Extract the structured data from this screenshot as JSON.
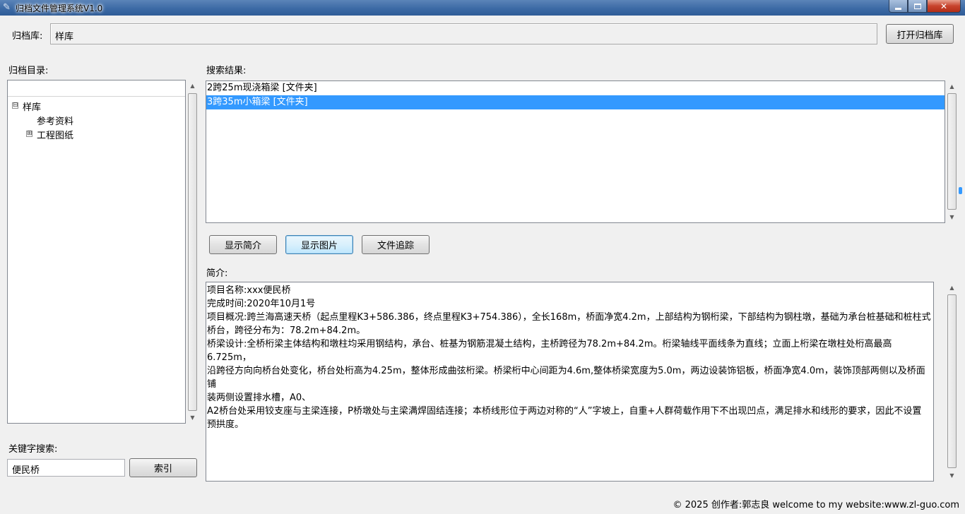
{
  "window": {
    "title": "归档文件管理系统V1.0",
    "controls": {
      "minimize": "minimize-icon",
      "maximize": "maximize-icon",
      "close": "close-icon"
    }
  },
  "archive": {
    "label": "归档库:",
    "path_value": "样库",
    "open_button": "打开归档库"
  },
  "directory": {
    "label": "归档目录:",
    "tree": [
      {
        "label": "样库",
        "expander": "⊟"
      },
      {
        "label": "参考资料"
      },
      {
        "label": "工程图纸",
        "expander": "⊞"
      }
    ]
  },
  "search_results": {
    "label": "搜索结果:",
    "rows": [
      {
        "text": "2跨25m现浇箱梁 [文件夹]",
        "selected": false
      },
      {
        "text": "3跨35m小箱梁 [文件夹]",
        "selected": true
      }
    ]
  },
  "actions": {
    "show_intro": "显示简介",
    "show_image": "显示图片",
    "file_trace": "文件追踪"
  },
  "intro": {
    "label": "简介:",
    "lines": [
      "项目名称:xxx便民桥",
      "完成时间:2020年10月1号",
      "项目概况:跨兰海高速天桥（起点里程K3+586.386，终点里程K3+754.386），全长168m，桥面净宽4.2m，上部结构为钢桁梁，下部结构为钢柱墩，基础为承台桩基础和桩柱式",
      "桥台，跨径分布为：78.2m+84.2m。",
      "桥梁设计:全桥桁梁主体结构和墩柱均采用钢结构，承台、桩基为钢筋混凝土结构，主桥跨径为78.2m+84.2m。桁梁轴线平面线条为直线；立面上桁梁在墩柱处桁高最高6.725m，",
      "沿跨径方向向桥台处变化，桥台处桁高为4.25m，整体形成曲弦桁梁。桥梁桁中心间距为4.6m,整体桥梁宽度为5.0m，两边设装饰铝板，桥面净宽4.0m，装饰顶部两侧以及桥面铺",
      "装两侧设置排水槽，A0、",
      "A2桥台处采用铰支座与主梁连接，P桥墩处与主梁满焊固结连接；本桥线形位于两边对称的“人”字坡上，自重+人群荷载作用下不出现凹点，满足排水和线形的要求，因此不设置",
      "预拱度。"
    ]
  },
  "keyword_search": {
    "label": "关键字搜索:",
    "value": "便民桥",
    "index_button": "索引"
  },
  "footer": {
    "text": "© 2025 创作者:郭志良 welcome to my website:www.zl-guo.com"
  }
}
